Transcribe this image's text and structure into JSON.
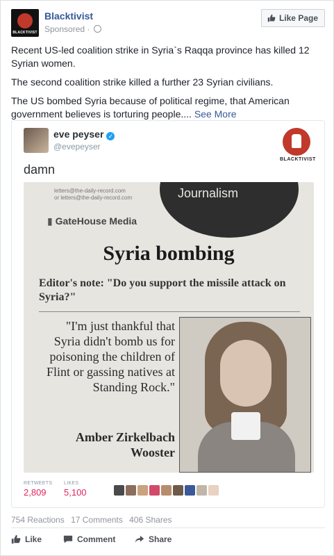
{
  "post": {
    "page_name": "Blacktivist",
    "avatar_text": "BLACKTIVIST",
    "sponsored": "Sponsored ·",
    "like_page_label": "Like Page",
    "paragraphs": [
      "Recent US-led coalition strike in Syria`s Raqqa province has killed 12 Syrian women.",
      "The second coalition strike killed a further 23 Syrian civilians.",
      "The US bombed Syria because of political regime, that American government believes is torturing people...."
    ],
    "see_more": "See More"
  },
  "tweet": {
    "name": "eve peyser",
    "handle": "@evepeyser",
    "text": "damn",
    "logo_label": "BLACKTIVIST",
    "retweets_label": "RETWEETS",
    "retweets": "2,809",
    "likes_label": "LIKES",
    "likes": "5,100",
    "liker_colors": [
      "#4a4a4a",
      "#8b6f5c",
      "#c9a27e",
      "#d24a6a",
      "#b58d6d",
      "#6d5a49",
      "#3b5998",
      "#c0b6a8",
      "#e8d2c2"
    ]
  },
  "newspaper": {
    "url_line1": "letters@the-daily-record.com",
    "url_line2": "or letters@the-daily-record.com",
    "journalism": "Journalism",
    "gatehouse": "GateHouse Media",
    "headline": "Syria bombing",
    "editor_note": "Editor's note: \"Do you support the missile attack on Syria?\"",
    "quote": "\"I'm just thankful that Syria didn't bomb us for poisoning the children of Flint or gassing natives at Standing Rock.\"",
    "author_name": "Amber Zirkelbach",
    "author_town": "Wooster"
  },
  "engagement": {
    "reactions": "754 Reactions",
    "comments": "17 Comments",
    "shares": "406 Shares"
  },
  "actions": {
    "like": "Like",
    "comment": "Comment",
    "share": "Share"
  }
}
